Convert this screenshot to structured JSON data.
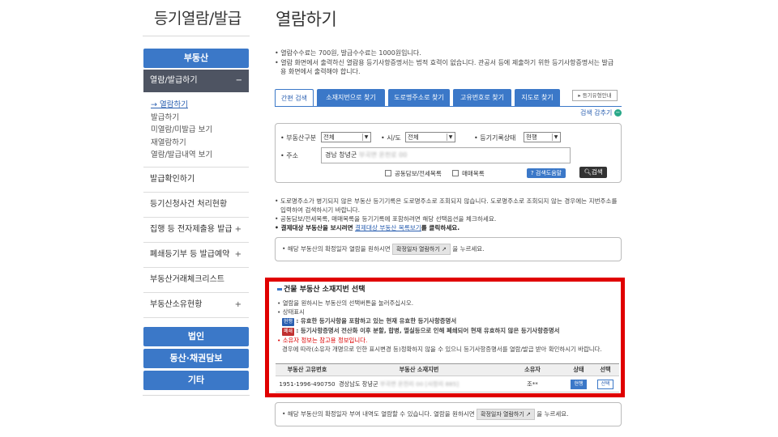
{
  "sidebar": {
    "title": "등기열람/발급",
    "realestate_btn": "부동산",
    "active_menu": "열람/발급하기",
    "active_toggle": "−",
    "submenu": [
      "→ 열람하기",
      "발급하기",
      "미열람/미발급 보기",
      "재열람하기",
      "열람/발급내역 보기"
    ],
    "menu_items": [
      {
        "label": "발급확인하기",
        "plus": ""
      },
      {
        "label": "등기신청사건 처리현황",
        "plus": ""
      },
      {
        "label": "집행 등 전자제출용 발급",
        "plus": "+"
      },
      {
        "label": "폐쇄등기부 등 발급예약",
        "plus": "+"
      },
      {
        "label": "부동산거래체크리스트",
        "plus": ""
      },
      {
        "label": "부동산소유현황",
        "plus": "+"
      }
    ],
    "bottom_buttons": [
      "법인",
      "동산·채권담보",
      "기타"
    ]
  },
  "main": {
    "title": "열람하기",
    "notes": [
      "• 열람수수료는 700원, 발급수수료는 1000원입니다.",
      "• 열람 화면에서 출력하신 열람용 등기사항증명서는 법적 효력이 없습니다. 관공서 등에 제출하기 위한 등기사항증명서는 발급용 화면에서 출력해야 합니다."
    ],
    "tabs": [
      "간편 검색",
      "소재지번으로 찾기",
      "도로명주소로 찾기",
      "고유번호로 찾기",
      "지도로 찾기"
    ],
    "guide_btn": "▸ 등기유형안내",
    "search_toggle": "검색 감추기",
    "search_toggle_icon": "−",
    "form": {
      "type_label": "• 부동산구분",
      "type_value": "전체",
      "region_label": "• 시/도",
      "region_value": "전체",
      "status_label": "• 등기기록상태",
      "status_value": "현행",
      "addr_label": "• 주소",
      "addr_value": "경남 창녕군",
      "addr_blur": "부곡면 온천로 00",
      "chk1": "공동담보/전세목록",
      "chk2": "매매목록",
      "help_btn": "검색도움말",
      "search_btn": "검색"
    },
    "notes2": [
      "• 도로명주소가 병기되지 않은 부동산 등기기록은 도로명주소로 조회되지 않습니다. 도로명주소로 조회되지 않는 경우에는 지번주소를 입력하여 검색하시기 바랍니다.",
      "• 공동담보/전세목록, 매매목록을 등기기록에 포함하려면 해당 선택옵션을 체크하세요."
    ],
    "notes2_bold_a": "• 결제대상 부동산을 보시려면",
    "notes2_link": "결제대상 부동산 목록보기",
    "notes2_bold_b": "를 클릭하세요.",
    "info1_pre": "• 해당 부동산의 확정일자 열람을 원하시면",
    "info1_btn": "확정일자 열람하기 ↗",
    "info1_post": "을 누르세요.",
    "section": {
      "title": "건물 부동산 소재지번 선택",
      "line1": "• 열람을 원하시는 부동산의 선택버튼을 눌러주십시오.",
      "line2": "• 상태표시",
      "badge_current": "현행",
      "current_desc": ": 유효한 등기사항을 포함하고 있는 현재 유효한 등기사항증명서",
      "badge_closed": "폐쇄",
      "closed_desc": ": 등기사항증명서 전산화 이후 분할, 합병, 멸실등으로 인해 폐쇄되어 현재 유효하지 않은 등기사항증명서",
      "owner_note": "• 소유자 정보는 참고용 정보입니다.",
      "owner_note2": "경우에 따라(소유자 개명으로 인한 표시변경 등)정확하지 않을 수 있으니 등기사항증명서를 열람/발급 받아 확인하시기 바랍니다."
    },
    "table": {
      "headers": [
        "부동산 고유번호",
        "부동산 소재지번",
        "소유자",
        "상태",
        "선택"
      ],
      "row": {
        "id": "1951-1996-490750",
        "addr": "경상남도 창녕군",
        "addr_blur": "부곡면 온천리 00 [사창리 885]",
        "owner": "조**",
        "status": "현행",
        "select": "선택"
      }
    },
    "info2_pre": "• 해당 부동산의 확정일자 부여 내역도 열람할 수 있습니다. 열람을 원하시면",
    "info2_btn": "확정일자 열람하기 ↗",
    "info2_post": "을 누르세요."
  },
  "colors": {
    "accent": "#3b78c8",
    "highlight": "#e00000",
    "dark": "#4e5462"
  }
}
